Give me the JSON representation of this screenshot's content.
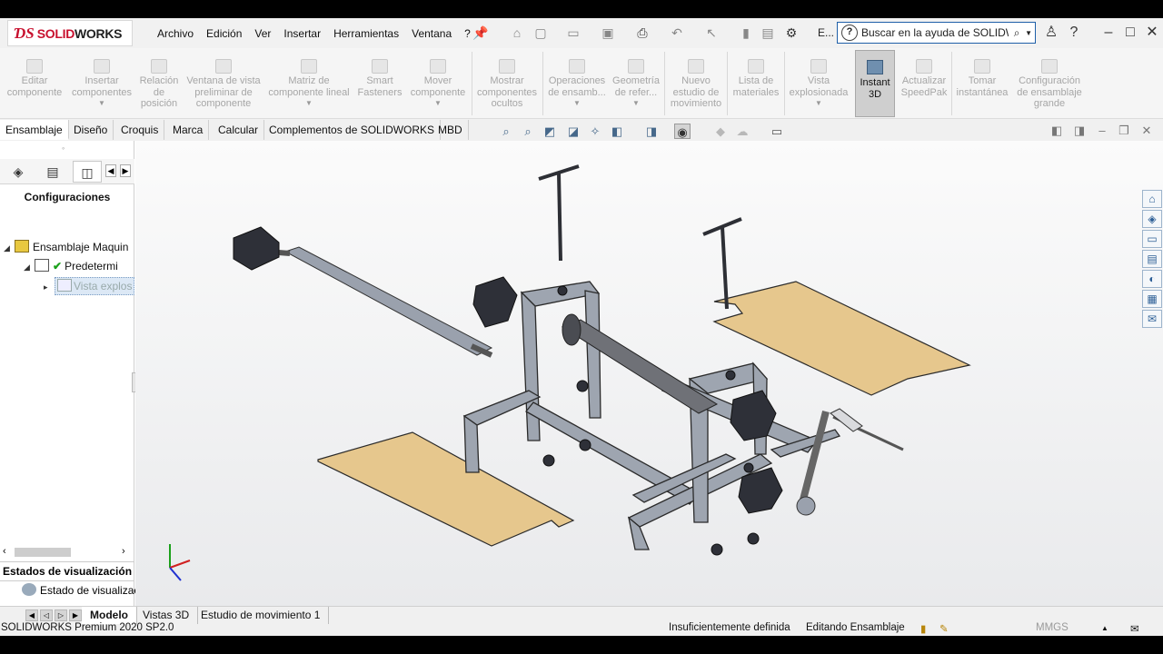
{
  "logo": {
    "brand_a": "SOLID",
    "brand_b": "WORKS"
  },
  "menu": [
    "Archivo",
    "Edición",
    "Ver",
    "Insertar",
    "Herramientas",
    "Ventana",
    "?"
  ],
  "search": {
    "value": "Buscar en la ayuda de SOLIDWOI"
  },
  "toolbar_cut_label": "E...",
  "commands": [
    {
      "label": "Editar componente"
    },
    {
      "label": "Insertar componentes"
    },
    {
      "label": "Relación de posición"
    },
    {
      "label": "Ventana de vista preliminar de componente"
    },
    {
      "label": "Matriz de componente lineal"
    },
    {
      "label": "Smart Fasteners"
    },
    {
      "label": "Mover componente"
    },
    {
      "label": "Mostrar componentes ocultos"
    },
    {
      "label": "Operaciones de ensamb..."
    },
    {
      "label": "Geometría de refer..."
    },
    {
      "label": "Nuevo estudio de movimiento"
    },
    {
      "label": "Lista de materiales"
    },
    {
      "label": "Vista explosionada"
    },
    {
      "label": "Instant 3D"
    },
    {
      "label": "Actualizar SpeedPak"
    },
    {
      "label": "Tomar instantánea"
    },
    {
      "label": "Configuración de ensamblaje grande"
    }
  ],
  "cm_tabs": [
    "Ensamblaje",
    "Diseño",
    "Croquis",
    "Marca",
    "Calcular",
    "Complementos de SOLIDWORKS",
    "MBD"
  ],
  "left_panel": {
    "title": "Configuraciones",
    "tree": [
      {
        "label": "Ensamblaje Maquin"
      },
      {
        "label": "Predetermi"
      },
      {
        "label": "Vista explos"
      }
    ],
    "display_states_header": "Estados de visualización",
    "display_state_item": "Estado de visualizac"
  },
  "bottom_tabs": [
    "Modelo",
    "Vistas 3D",
    "Estudio de movimiento 1"
  ],
  "status": {
    "product": "SOLIDWORKS Premium 2020 SP2.0",
    "definition": "Insuficientemente definida",
    "mode": "Editando Ensamblaje",
    "units": "MMGS"
  },
  "icons": {
    "home": "home-icon",
    "new": "new-document-icon",
    "open": "open-icon",
    "save": "save-icon",
    "print": "print-icon",
    "undo": "undo-icon",
    "select": "select-icon",
    "rebuild": "rebuild-icon",
    "options": "gear-icon",
    "help": "question-icon",
    "user": "user-icon"
  },
  "colors": {
    "accent": "#c8102e",
    "search_border": "#1e5fa8",
    "wood": "#e7c88e",
    "steel": "#9aa1ad"
  }
}
